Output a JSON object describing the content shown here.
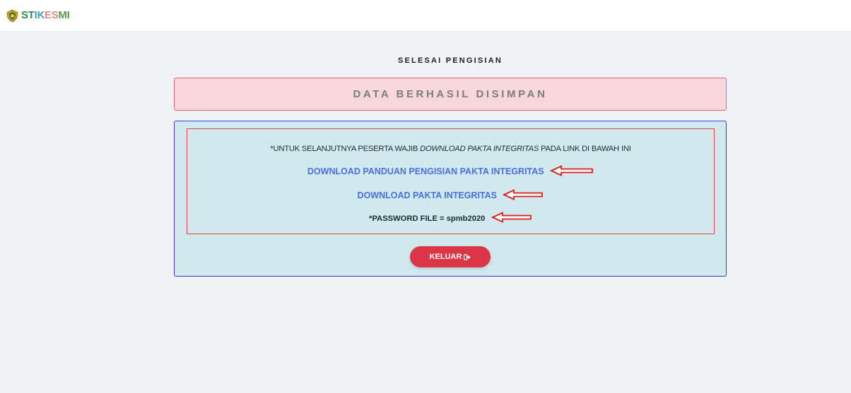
{
  "brand": {
    "logo_icon": "shield-emblem-icon",
    "name_parts": [
      "ST",
      "IK",
      "ES",
      "MI"
    ]
  },
  "heading": "SELESAI PENGISIAN",
  "alert": {
    "text": "DATA BERHASIL DISIMPAN",
    "bg_color": "#f8d7da",
    "border_color": "#e26a73"
  },
  "panel": {
    "instruction_prefix": "*UNTUK SELANJUTNYA PESERTA WAJIB ",
    "instruction_italic": "DOWNLOAD PAKTA INTEGRITAS",
    "instruction_suffix": " PADA LINK DI BAWAH INI",
    "link_guide": "DOWNLOAD PANDUAN PENGISIAN PAKTA INTEGRITAS",
    "link_pakta": "DOWNLOAD PAKTA INTEGRITAS",
    "password_text": "*PASSWORD FILE = spmb2020",
    "arrow_icon": "red-left-arrow-icon",
    "link_color": "#4a6ee0"
  },
  "logout": {
    "label": "KELUAR",
    "icon": "sign-out-icon",
    "color": "#dc3545"
  }
}
